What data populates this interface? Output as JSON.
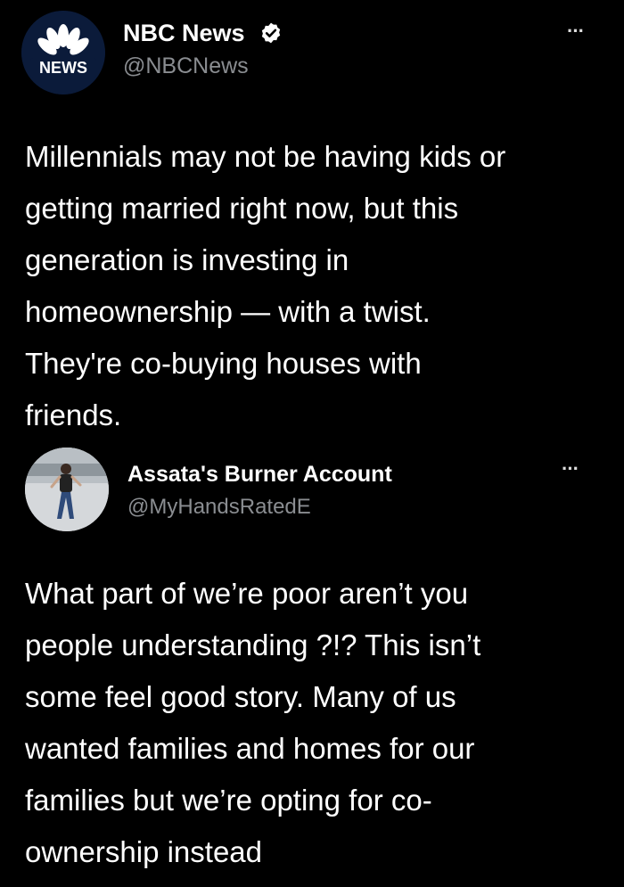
{
  "tweets": [
    {
      "avatar_label": "NEWS",
      "display_name": "NBC News",
      "handle": "@NBCNews",
      "verified": true,
      "more_label": "···",
      "text_lines": [
        "Millennials may not be having kids or",
        "getting married right now, but this",
        "generation is investing in",
        "homeownership — with a twist.",
        "They're co-buying houses with",
        "friends."
      ]
    },
    {
      "display_name": "Assata's Burner Account",
      "handle": "@MyHandsRatedE",
      "more_label": "···",
      "text_lines": [
        "What part of we’re poor aren’t you",
        "people understanding ?!? This isn’t",
        "some feel good story. Many of us",
        "wanted families and homes for our",
        "families but we’re opting for co-",
        "ownership instead"
      ]
    }
  ],
  "colors": {
    "background": "#000000",
    "text": "#ffffff",
    "handle": "#8a8d91",
    "verified_badge": "#ffffff",
    "nbc_avatar": "#0b1b3a"
  },
  "icons": [
    "nbc-peacock-logo-icon",
    "verified-badge-icon",
    "more-options-icon"
  ]
}
